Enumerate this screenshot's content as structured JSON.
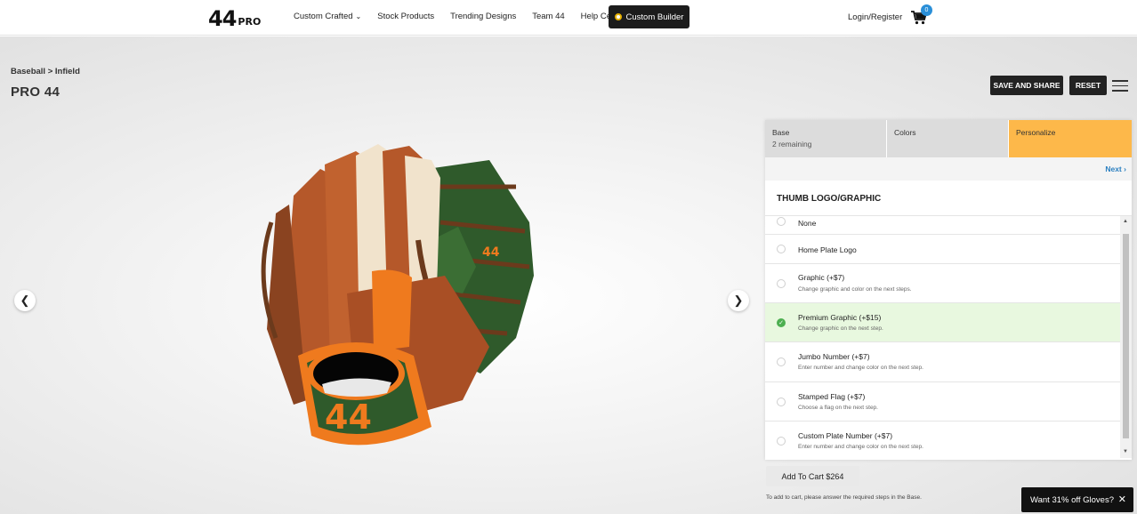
{
  "header": {
    "logo_main": "44",
    "logo_sub": "PRO",
    "nav": [
      "Custom Crafted",
      "Stock Products",
      "Trending Designs",
      "Team 44",
      "Help Center"
    ],
    "builder_label": "Custom Builder",
    "login_label": "Login/Register",
    "cart_count": "0"
  },
  "product": {
    "breadcrumb": "Baseball > Infield",
    "title": "PRO 44",
    "save_label": "SAVE AND SHARE",
    "reset_label": "RESET",
    "glove_logo": "44"
  },
  "panel": {
    "tabs": [
      {
        "label": "Base",
        "sub": "2 remaining"
      },
      {
        "label": "Colors",
        "sub": ""
      },
      {
        "label": "Personalize",
        "sub": ""
      }
    ],
    "next_label": "Next",
    "section_title": "THUMB LOGO/GRAPHIC",
    "options": [
      {
        "label": "None",
        "desc": "",
        "selected": false
      },
      {
        "label": "Home Plate Logo",
        "desc": "",
        "selected": false
      },
      {
        "label": "Graphic (+$7)",
        "desc": "Change graphic and color on the next steps.",
        "selected": false
      },
      {
        "label": "Premium Graphic (+$15)",
        "desc": "Change graphic on the next step.",
        "selected": true
      },
      {
        "label": "Jumbo Number (+$7)",
        "desc": "Enter number and change color on the next step.",
        "selected": false
      },
      {
        "label": "Stamped Flag (+$7)",
        "desc": "Choose a flag on the next step.",
        "selected": false
      },
      {
        "label": "Custom Plate Number (+$7)",
        "desc": "Enter number and change color on the next step.",
        "selected": false
      }
    ]
  },
  "cart": {
    "add_label": "Add To Cart $264",
    "note": "To add to cart, please answer the required steps in the Base."
  },
  "promo": {
    "text": "Want 31% off Gloves?"
  },
  "colors": {
    "accent_orange": "#fdb84a",
    "glove_brown": "#b5582a",
    "glove_green": "#2f5a2b",
    "glove_cream": "#f1e3cc",
    "glove_orange": "#ef7a1e",
    "link_blue": "#2a7fc0",
    "check_green": "#4caf50"
  },
  "icons": [
    "cart-icon",
    "chevron-left-icon",
    "chevron-right-icon",
    "hamburger-icon",
    "check-icon",
    "close-icon"
  ]
}
